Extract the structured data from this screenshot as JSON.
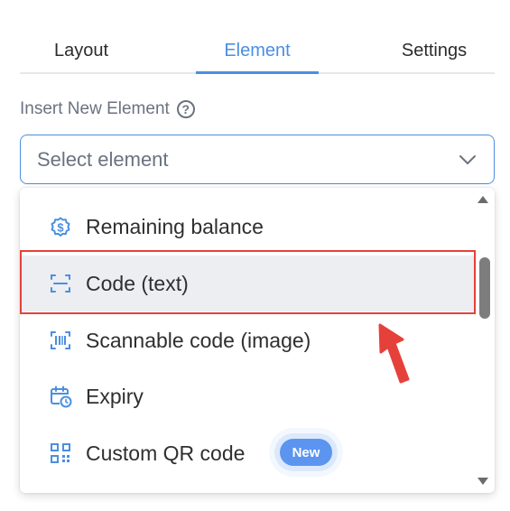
{
  "tabs": [
    {
      "label": "Layout"
    },
    {
      "label": "Element",
      "active": true
    },
    {
      "label": "Settings"
    }
  ],
  "insert": {
    "label": "Insert New Element",
    "help_icon": "?"
  },
  "select": {
    "placeholder": "Select element",
    "icon": "chevron-down-icon"
  },
  "dropdown": {
    "items": [
      {
        "label": "Remaining balance",
        "icon": "dollar-circle-icon"
      },
      {
        "label": "Code (text)",
        "icon": "code-text-icon",
        "highlighted": true
      },
      {
        "label": "Scannable code (image)",
        "icon": "barcode-scan-icon"
      },
      {
        "label": "Expiry",
        "icon": "calendar-clock-icon"
      },
      {
        "label": "Custom QR code",
        "icon": "qr-code-icon",
        "badge": "New"
      }
    ]
  },
  "colors": {
    "accent": "#4a8fe0",
    "highlight_border": "#e5413a",
    "badge_bg": "#5b95f0",
    "selected_row_bg": "#eceef2"
  }
}
